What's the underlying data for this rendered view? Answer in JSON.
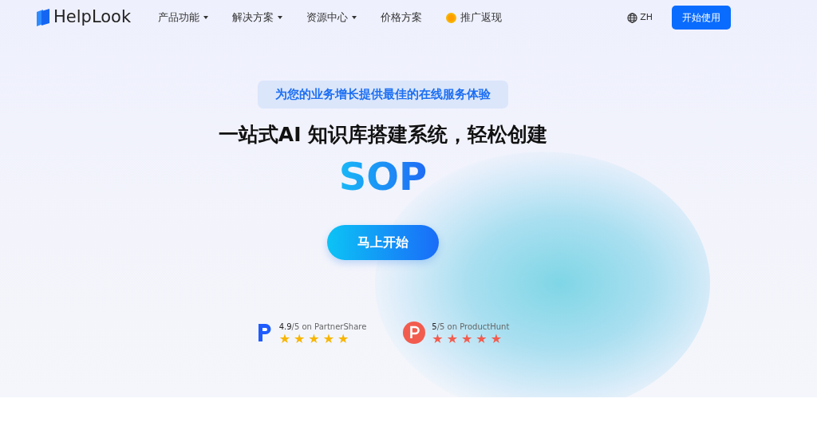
{
  "brand": {
    "name": "HelpLook"
  },
  "nav": [
    {
      "label": "产品功能",
      "kind": "dropdown"
    },
    {
      "label": "解决方案",
      "kind": "dropdown"
    },
    {
      "label": "资源中心",
      "kind": "dropdown"
    },
    {
      "label": "价格方案",
      "kind": "link"
    },
    {
      "label": "推广返现",
      "kind": "coin"
    }
  ],
  "language": "ZH",
  "cta_button": "开始使用",
  "hero": {
    "tagline": "为您的业务增长提供最佳的在线服务体验",
    "headline": "一站式AI 知识库搭建系统，轻松创建",
    "highlight": "SOP",
    "button": "马上开始"
  },
  "ratings": [
    {
      "score": "4.9",
      "suffix": "/5 on PartnerShare",
      "stars": 5,
      "kind": "partnershare",
      "color": "#f7b500"
    },
    {
      "score": "5",
      "suffix": "/5 on ProductHunt",
      "stars": 5,
      "kind": "producthunt",
      "color": "#f25c4e"
    }
  ]
}
